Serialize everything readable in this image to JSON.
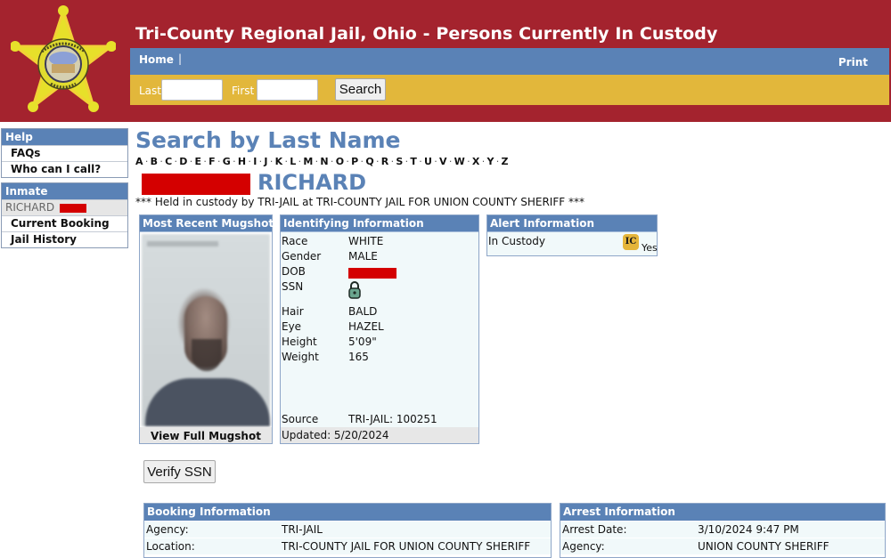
{
  "header": {
    "title": "Tri-County Regional Jail, Ohio - Persons Currently In Custody",
    "badge_icon": "sheriff-star-badge-icon",
    "badge_text_top": "TRI-COUNTY",
    "badge_text_bottom": "JAIL",
    "colors": {
      "header_bg": "#a4232e",
      "nav_bg": "#5a82b6",
      "search_bg": "#e2b73b"
    }
  },
  "nav": {
    "home": "Home",
    "separator": "|",
    "print": "Print"
  },
  "search": {
    "last_label": "Last",
    "last_value": "",
    "first_label": "First",
    "first_value": "",
    "button": "Search"
  },
  "sidebar": {
    "help": {
      "title": "Help",
      "items": [
        {
          "label": "FAQs"
        },
        {
          "label": "Who can I call?"
        }
      ]
    },
    "inmate": {
      "title": "Inmate",
      "current": "RICHARD",
      "items": [
        {
          "label": "Current Booking"
        },
        {
          "label": "Jail History"
        }
      ]
    }
  },
  "main": {
    "title": "Search by Last Name",
    "alphabet": [
      "A",
      "B",
      "C",
      "D",
      "E",
      "F",
      "G",
      "H",
      "I",
      "J",
      "K",
      "L",
      "M",
      "N",
      "O",
      "P",
      "Q",
      "R",
      "S",
      "T",
      "U",
      "V",
      "W",
      "X",
      "Y",
      "Z"
    ],
    "inmate_first_name": "RICHARD",
    "custody_note": "*** Held in custody by TRI-JAIL at TRI-COUNTY JAIL FOR UNION COUNTY SHERIFF ***"
  },
  "mugshot": {
    "title": "Most Recent Mugshot",
    "view_full": "View Full Mugshot"
  },
  "identifying": {
    "title": "Identifying Information",
    "rows": [
      {
        "label": "Race",
        "value": "WHITE"
      },
      {
        "label": "Gender",
        "value": "MALE"
      },
      {
        "label": "DOB",
        "value": "",
        "redacted": true
      },
      {
        "label": "SSN",
        "value": "",
        "icon": "lock-icon"
      },
      {
        "label": "Hair",
        "value": "BALD"
      },
      {
        "label": "Eye",
        "value": "HAZEL"
      },
      {
        "label": "Height",
        "value": "5'09\""
      },
      {
        "label": "Weight",
        "value": "165"
      }
    ],
    "source_label": "Source",
    "source_value": "TRI-JAIL: 100251",
    "updated": "Updated: 5/20/2024"
  },
  "alert": {
    "title": "Alert Information",
    "label": "In Custody",
    "icon_text": "IC",
    "value": "Yes"
  },
  "verify_ssn": "Verify SSN",
  "booking": {
    "title": "Booking Information",
    "rows": [
      {
        "label": "Agency:",
        "value": "TRI-JAIL"
      },
      {
        "label": "Location:",
        "value": "TRI-COUNTY JAIL FOR UNION COUNTY SHERIFF"
      }
    ]
  },
  "arrest": {
    "title": "Arrest Information",
    "rows": [
      {
        "label": "Arrest Date:",
        "value": "3/10/2024 9:47 PM"
      },
      {
        "label": "Agency:",
        "value": "UNION COUNTY SHERIFF"
      }
    ]
  }
}
